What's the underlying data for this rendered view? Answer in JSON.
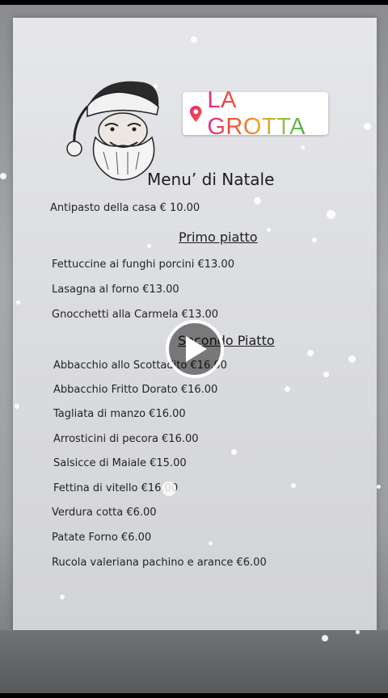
{
  "sticker": {
    "location_label": "LA GROTTA",
    "icon": "location-pin-icon"
  },
  "menu": {
    "title": "Menu’ di Natale",
    "antipasto": "Antipasto della casa € 10.00",
    "primo_title": "Primo piatto",
    "primi": [
      "Fettuccine ai funghi porcini €13.00",
      "Lasagna al forno €13.00",
      "Gnocchetti alla Carmela €13.00"
    ],
    "secondo_title": "Secondo Piatto",
    "secondi": [
      "Abbacchio allo Scottadito €16.00",
      "Abbacchio Fritto Dorato €16.00",
      "Tagliata di manzo €16.00",
      "Arrosticini di pecora €16.00",
      "Salsicce di Maiale €15.00",
      "Fettina di vitello €16.00",
      "Verdura cotta €6.00",
      "Patate Forno €6.00",
      "Rucola valeriana pachino e arance €6.00"
    ]
  },
  "video": {
    "play_icon": "play-icon"
  },
  "colors": {
    "paper": "#dcdde0",
    "text": "#222326",
    "sticker_bg": "#ffffff"
  }
}
